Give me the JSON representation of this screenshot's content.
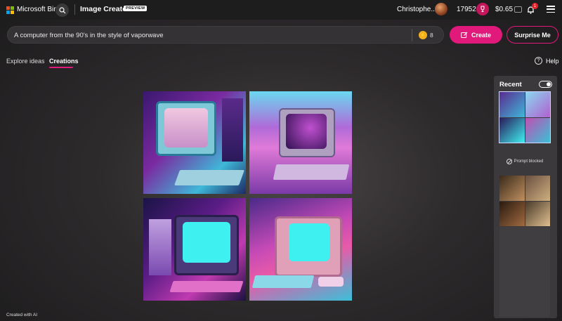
{
  "header": {
    "brand": "Microsoft Bing",
    "app_title": "Image Creator",
    "preview_badge": "PREVIEW",
    "user_name": "Christophe...",
    "points": "17952",
    "balance": "$0.65",
    "notification_count": "1",
    "icons": [
      "microsoft-logo-icon",
      "search-icon",
      "rewards-icon",
      "wallet-icon",
      "bell-icon",
      "hamburger-menu-icon"
    ]
  },
  "prompt": {
    "value": "A computer from the 90's in the style of vaporwave",
    "boost_count": "8",
    "create_label": "Create",
    "surprise_label": "Surprise Me"
  },
  "tabs": [
    {
      "label": "Explore ideas",
      "active": false
    },
    {
      "label": "Creations",
      "active": true
    }
  ],
  "help_label": "Help",
  "recent": {
    "title": "Recent",
    "blocked_label": "Prompt blocked",
    "toggle_on": true
  },
  "footer": "Created with AI",
  "colors": {
    "accent": "#e0197a",
    "background": "#2e2b2d",
    "panel": "#3b393b",
    "boost": "#f2b01e"
  }
}
